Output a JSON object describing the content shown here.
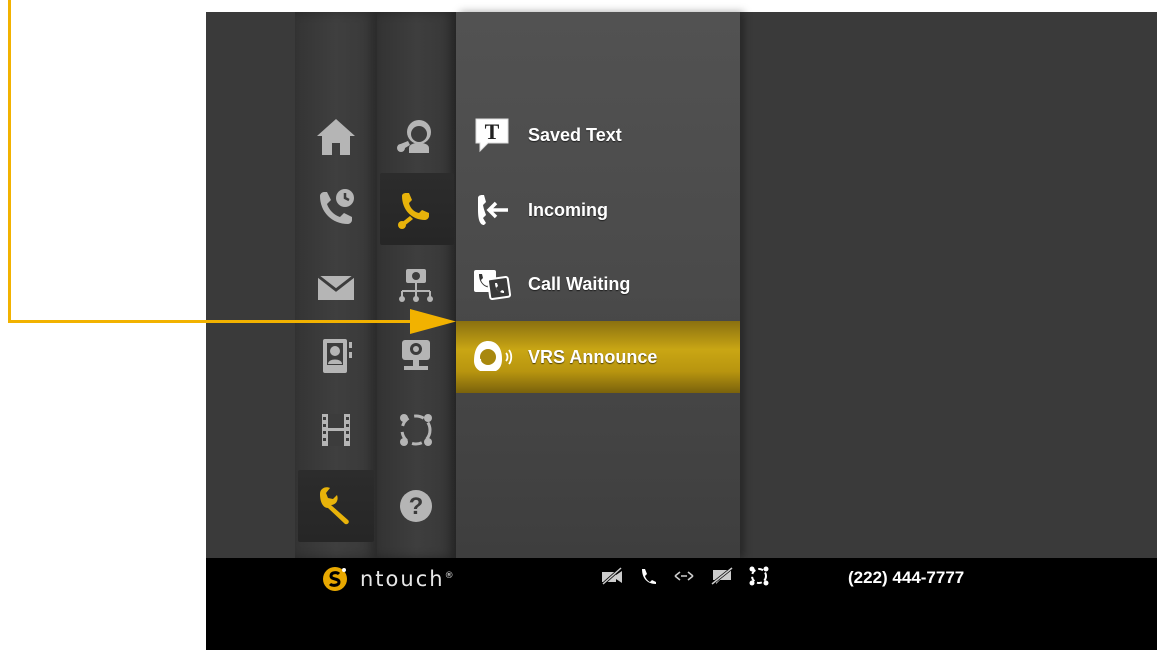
{
  "colors": {
    "accent": "#f2b200",
    "selected_bar": "#c9a614",
    "icon_gray": "#b5b5b5",
    "icon_active": "#e8b30a"
  },
  "main_nav": [
    {
      "icon": "home-icon",
      "active": false
    },
    {
      "icon": "call-history-icon",
      "active": false
    },
    {
      "icon": "mail-icon",
      "active": false
    },
    {
      "icon": "contacts-book-icon",
      "active": false
    },
    {
      "icon": "video-film-icon",
      "active": false
    },
    {
      "icon": "settings-wrench-icon",
      "active": true
    }
  ],
  "settings_nav": [
    {
      "icon": "personal-settings-icon",
      "active": false
    },
    {
      "icon": "call-settings-icon",
      "active": true
    },
    {
      "icon": "network-icon",
      "active": false
    },
    {
      "icon": "camera-icon",
      "active": false
    },
    {
      "icon": "ring-light-icon",
      "active": false
    },
    {
      "icon": "help-icon",
      "active": false
    }
  ],
  "call_settings_menu": {
    "items": [
      {
        "label": "Saved Text",
        "icon": "saved-text-icon",
        "selected": false
      },
      {
        "label": "Incoming",
        "icon": "incoming-call-icon",
        "selected": false
      },
      {
        "label": "Call Waiting",
        "icon": "call-waiting-icon",
        "selected": false
      },
      {
        "label": "VRS Announce",
        "icon": "vrs-announce-icon",
        "selected": true
      }
    ]
  },
  "status_bar": {
    "brand": "ntouch",
    "brand_mark": "®",
    "status_icons": [
      "video-off-icon",
      "phone-icon",
      "network-arrows-icon",
      "privacy-off-icon",
      "ring-light-icon"
    ],
    "phone_number": "(222) 444-7777"
  }
}
